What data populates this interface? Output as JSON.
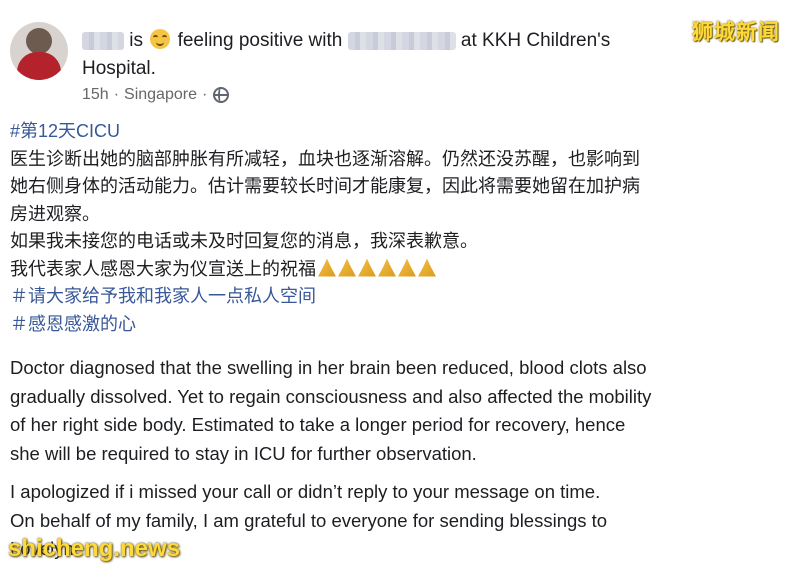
{
  "post": {
    "header": {
      "is_word": "is",
      "feeling_text": "feeling positive with",
      "at_text": "at KKH Children's",
      "location_line2": "Hospital.",
      "time": "15h",
      "separator": "·",
      "place": "Singapore",
      "separator2": "·"
    },
    "chinese": {
      "hashtag1": "#第12天CICU",
      "para1_line1": "医生诊断出她的脑部肿胀有所减轻，血块也逐渐溶解。仍然还没苏醒，也影响到",
      "para1_line2": "她右侧身体的活动能力。估计需要较长时间才能康复，因此将需要她留在加护病",
      "para1_line3": "房进观察。",
      "para2": "如果我未接您的电话或未及时回复您的消息，我深表歉意。",
      "para3": "我代表家人感恩大家为仪宣送上的祝福",
      "hashtag2": "＃请大家给予我和我家人一点私人空间",
      "hashtag3": "＃感恩感激的心"
    },
    "english": {
      "line1": "Doctor diagnosed that the swelling in her brain been reduced, blood clots also",
      "line2": "gradually dissolved. Yet to regain consciousness and also affected the mobility",
      "line3": "of her right side body. Estimated to take a longer period for recovery, hence",
      "line4": "she will be required to stay in ICU for further observation.",
      "line5": "I apologized if i missed your call or didn’t reply to your message on time.",
      "line6": "On behalf of my family, I am grateful to everyone for sending blessings to",
      "line7": "Lovelyn."
    }
  },
  "watermarks": {
    "top_right": "狮城新闻",
    "bottom_left": "shicheng.news"
  },
  "icons": {
    "emoji": "relieved-face-icon",
    "globe": "globe-icon",
    "hands": "folded-hands-icon"
  }
}
